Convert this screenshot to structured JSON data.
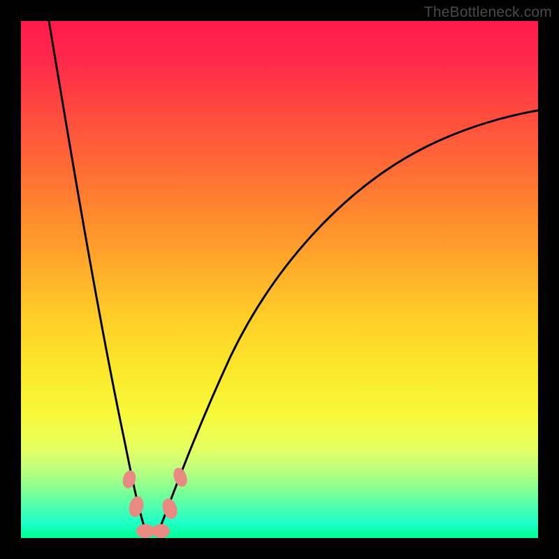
{
  "watermark": "TheBottleneck.com",
  "colors": {
    "background": "#000000",
    "curve": "#000000",
    "blob": "#e88a82",
    "gradient_top": "#ff1a4d",
    "gradient_bottom": "#00ff91"
  },
  "chart_data": {
    "type": "line",
    "title": "",
    "xlabel": "",
    "ylabel": "",
    "xlim": [
      0,
      100
    ],
    "ylim": [
      0,
      100
    ],
    "note": "Bottleneck-style V curve. y=0 is green (good), y=100 is red (bad). Minimum near x≈24.",
    "series": [
      {
        "name": "left_branch",
        "x": [
          5,
          8,
          11,
          14,
          17,
          20,
          22,
          24
        ],
        "values": [
          100,
          82,
          64,
          47,
          30,
          14,
          6,
          0
        ]
      },
      {
        "name": "right_branch",
        "x": [
          24,
          28,
          33,
          40,
          48,
          58,
          70,
          85,
          100
        ],
        "values": [
          0,
          6,
          16,
          30,
          44,
          57,
          68,
          77,
          81
        ]
      }
    ],
    "markers": [
      {
        "name": "blob_left_upper",
        "x": 20.5,
        "y": 11
      },
      {
        "name": "blob_left_lower",
        "x": 21.8,
        "y": 5
      },
      {
        "name": "blob_bottom_1",
        "x": 23.5,
        "y": 1
      },
      {
        "name": "blob_bottom_2",
        "x": 26.5,
        "y": 1
      },
      {
        "name": "blob_right_lower",
        "x": 28.5,
        "y": 5
      },
      {
        "name": "blob_right_upper",
        "x": 30.5,
        "y": 12
      }
    ]
  }
}
